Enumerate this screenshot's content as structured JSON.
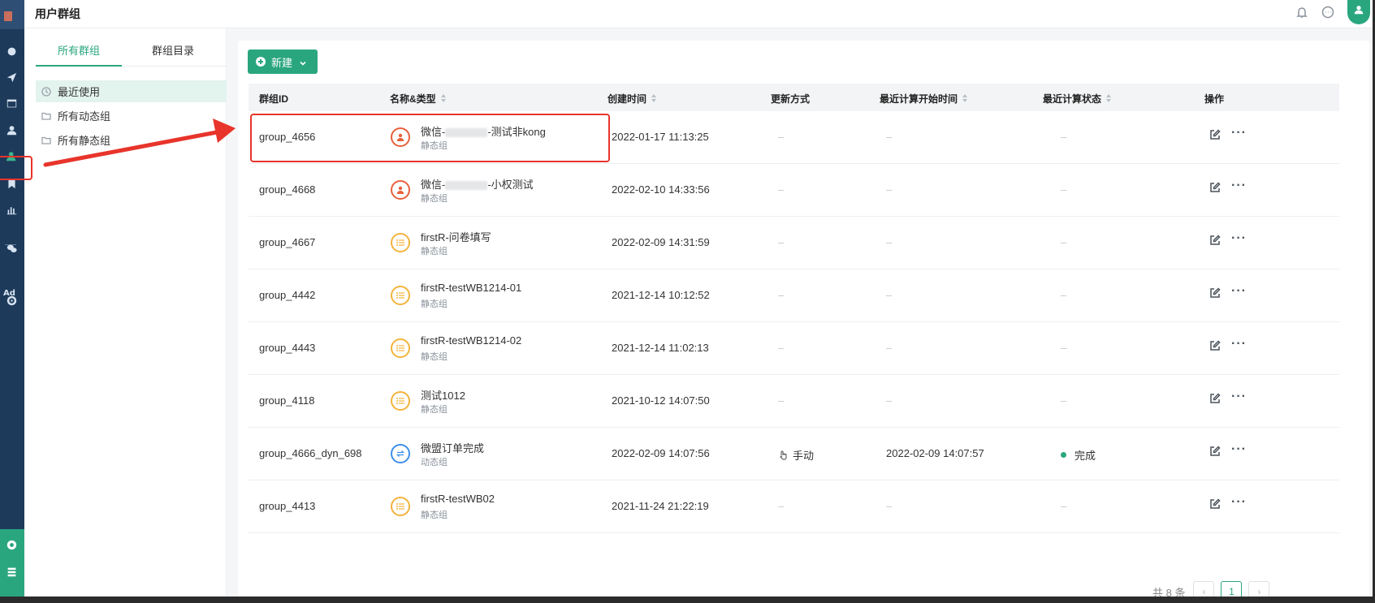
{
  "page_title": "用户群组",
  "left_panel": {
    "tabs": [
      "所有群组",
      "群组目录"
    ],
    "items": [
      "最近使用",
      "所有动态组",
      "所有静态组"
    ]
  },
  "new_button": {
    "label": "新建"
  },
  "table": {
    "headers": {
      "id": "群组ID",
      "name": "名称&类型",
      "created": "创建时间",
      "update": "更新方式",
      "laststart": "最近计算开始时间",
      "status": "最近计算状态",
      "actions": "操作"
    },
    "rows": [
      {
        "id": "group_4656",
        "name_prefix": "微信-",
        "name_suffix": "-测试非kong",
        "type": "静态组",
        "icon": "user-circle-icon",
        "created": "2022-01-17 11:13:25",
        "update": "–",
        "laststart": "–",
        "status": "–"
      },
      {
        "id": "group_4668",
        "name_prefix": "微信-",
        "name_suffix": "-小权测试",
        "type": "静态组",
        "icon": "user-circle-icon",
        "created": "2022-02-10 14:33:56",
        "update": "–",
        "laststart": "–",
        "status": "–"
      },
      {
        "id": "group_4667",
        "name": "firstR-问卷填写",
        "type": "静态组",
        "icon": "list-icon",
        "created": "2022-02-09 14:31:59",
        "update": "–",
        "laststart": "–",
        "status": "–"
      },
      {
        "id": "group_4442",
        "name": "firstR-testWB1214-01",
        "type": "静态组",
        "icon": "list-icon",
        "created": "2021-12-14 10:12:52",
        "update": "–",
        "laststart": "–",
        "status": "–"
      },
      {
        "id": "group_4443",
        "name": "firstR-testWB1214-02",
        "type": "静态组",
        "icon": "list-icon",
        "created": "2021-12-14 11:02:13",
        "update": "–",
        "laststart": "–",
        "status": "–"
      },
      {
        "id": "group_4118",
        "name": "测试1012",
        "type": "静态组",
        "icon": "list-icon",
        "created": "2021-10-12 14:07:50",
        "update": "–",
        "laststart": "–",
        "status": "–"
      },
      {
        "id": "group_4666_dyn_698",
        "name": "微盟订单完成",
        "type": "动态组",
        "icon": "refresh-icon",
        "created": "2022-02-09 14:07:56",
        "update": "手动",
        "laststart": "2022-02-09 14:07:57",
        "status": "完成"
      },
      {
        "id": "group_4413",
        "name": "firstR-testWB02",
        "type": "静态组",
        "icon": "list-icon",
        "created": "2021-11-24 21:22:19",
        "update": "–",
        "laststart": "–",
        "status": "–"
      }
    ]
  },
  "pagination": {
    "total": "共 8 条",
    "prev": "‹",
    "current": "1",
    "next": "›"
  },
  "colors": {
    "accent": "#2aa67f",
    "rail": "#1e3a5b",
    "annotation": "#e8342b",
    "user_icon": "#e8603c",
    "list_icon": "#f3b33d",
    "dynamic_icon": "#3d8fe8"
  }
}
